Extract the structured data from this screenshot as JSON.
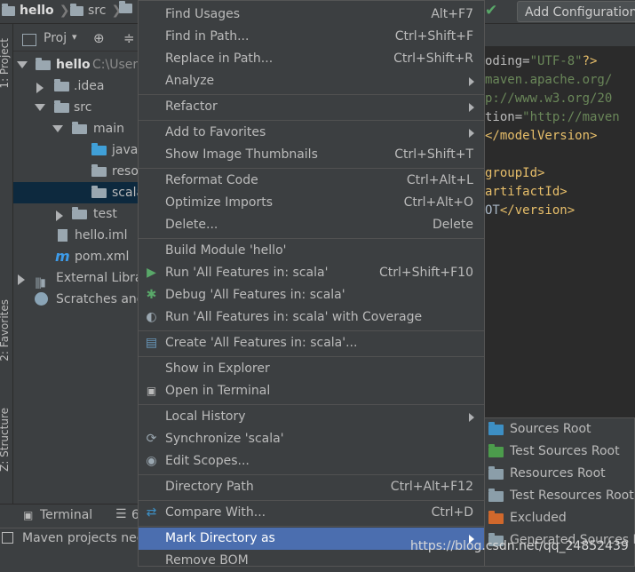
{
  "breadcrumb": {
    "project": "hello",
    "folder1": "src",
    "folder2": ""
  },
  "toolbar": {
    "add_configuration": "Add Configuration"
  },
  "left_strip": {
    "project_tab": "1: Project",
    "favorites_tab": "2: Favorites",
    "structure_tab": "Z: Structure"
  },
  "project_panel": {
    "header_label": "Proj",
    "tree": [
      {
        "label": "hello",
        "extra": "C:\\Users"
      },
      {
        "label": ".idea"
      },
      {
        "label": "src"
      },
      {
        "label": "main"
      },
      {
        "label": "java"
      },
      {
        "label": "reso"
      },
      {
        "label": "scala"
      },
      {
        "label": "test"
      },
      {
        "label": "hello.iml"
      },
      {
        "label": "pom.xml"
      },
      {
        "label": "External Libra"
      },
      {
        "label": "Scratches and"
      }
    ]
  },
  "editor": {
    "lines": [
      {
        "a": "oding=",
        "b": "\"UTF-8\"",
        "c": "?>"
      },
      {
        "a": "",
        "b": "maven.apache.org/",
        "c": ""
      },
      {
        "a": "",
        "b": "p://www.w3.org/20",
        "c": ""
      },
      {
        "a": "tion=",
        "b": "\"http://maven",
        "c": ""
      },
      {
        "a": "",
        "b": "</modelVersion>",
        "c": ""
      },
      {
        "a": "",
        "b": "",
        "c": ""
      },
      {
        "a": "",
        "b": "groupId>",
        "c": ""
      },
      {
        "a": "",
        "b": "artifactId>",
        "c": ""
      },
      {
        "a": "OT",
        "b": "</version>",
        "c": ""
      }
    ]
  },
  "bottom": {
    "terminal_tab": "Terminal",
    "second_tab": "6",
    "status_text": "Maven projects nee"
  },
  "menu": {
    "items": [
      {
        "label": "Find Usages",
        "shortcut": "Alt+F7"
      },
      {
        "label": "Find in Path...",
        "shortcut": "Ctrl+Shift+F"
      },
      {
        "label": "Replace in Path...",
        "shortcut": "Ctrl+Shift+R"
      },
      {
        "label": "Analyze",
        "shortcut": ""
      },
      {
        "label": "Refactor",
        "shortcut": ""
      },
      {
        "label": "Add to Favorites",
        "shortcut": ""
      },
      {
        "label": "Show Image Thumbnails",
        "shortcut": "Ctrl+Shift+T"
      },
      {
        "label": "Reformat Code",
        "shortcut": "Ctrl+Alt+L"
      },
      {
        "label": "Optimize Imports",
        "shortcut": "Ctrl+Alt+O"
      },
      {
        "label": "Delete...",
        "shortcut": "Delete"
      },
      {
        "label": "Build Module 'hello'",
        "shortcut": ""
      },
      {
        "label": "Run 'All Features in: scala'",
        "shortcut": "Ctrl+Shift+F10"
      },
      {
        "label": "Debug 'All Features in: scala'",
        "shortcut": ""
      },
      {
        "label": "Run 'All Features in: scala' with Coverage",
        "shortcut": ""
      },
      {
        "label": "Create 'All Features in: scala'...",
        "shortcut": ""
      },
      {
        "label": "Show in Explorer",
        "shortcut": ""
      },
      {
        "label": "Open in Terminal",
        "shortcut": ""
      },
      {
        "label": "Local History",
        "shortcut": ""
      },
      {
        "label": "Synchronize 'scala'",
        "shortcut": ""
      },
      {
        "label": "Edit Scopes...",
        "shortcut": ""
      },
      {
        "label": "Directory Path",
        "shortcut": "Ctrl+Alt+F12"
      },
      {
        "label": "Compare With...",
        "shortcut": "Ctrl+D"
      },
      {
        "label": "Mark Directory as",
        "shortcut": ""
      },
      {
        "label": "Remove BOM",
        "shortcut": ""
      }
    ]
  },
  "submenu": {
    "items": [
      {
        "label": "Sources Root",
        "color": "#3d8fc4"
      },
      {
        "label": "Test Sources Root",
        "color": "#4c9c4c"
      },
      {
        "label": "Resources Root",
        "color": "#8b9ea9"
      },
      {
        "label": "Test Resources Root",
        "color": "#8b9ea9"
      },
      {
        "label": "Excluded",
        "color": "#d0682c"
      },
      {
        "label": "Generated Sources Ro",
        "color": "#8b9ea9"
      }
    ]
  },
  "watermark": "https://blog.csdn.net/qq_24852439"
}
